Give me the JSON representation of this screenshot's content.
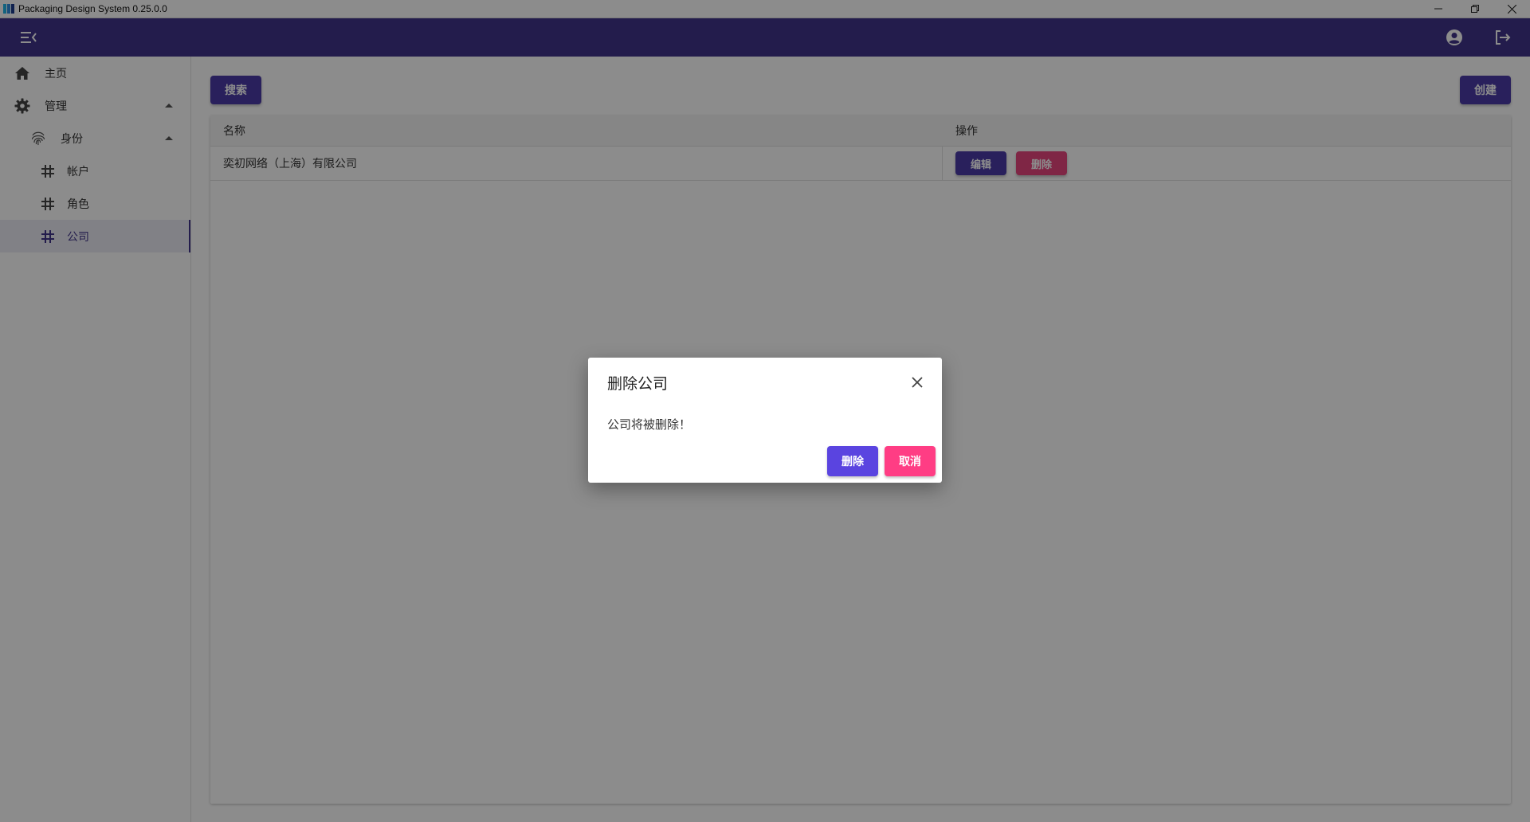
{
  "window": {
    "title": "Packaging Design System 0.25.0.0"
  },
  "colors": {
    "appbar": "#40348a",
    "primary": "#4b3ba8",
    "danger": "#e8457f",
    "dialog_confirm": "#5a44e0",
    "dialog_cancel": "#ff3d84"
  },
  "appbar": {
    "menu_icon": "menu-open-icon",
    "account_icon": "account-circle-icon",
    "logout_icon": "logout-icon"
  },
  "sidebar": {
    "home": {
      "label": "主页",
      "icon": "home-icon"
    },
    "manage": {
      "label": "管理",
      "icon": "gear-icon",
      "expanded": true
    },
    "identity": {
      "label": "身份",
      "icon": "fingerprint-icon",
      "expanded": true
    },
    "items": [
      {
        "label": "帐户",
        "icon": "hash-icon",
        "active": false
      },
      {
        "label": "角色",
        "icon": "hash-icon",
        "active": false
      },
      {
        "label": "公司",
        "icon": "hash-icon",
        "active": true
      }
    ]
  },
  "toolbar": {
    "search_label": "搜索",
    "create_label": "创建"
  },
  "table": {
    "columns": [
      "名称",
      "操作"
    ],
    "rows": [
      {
        "name": "奕初网络（上海）有限公司",
        "edit_label": "编辑",
        "delete_label": "删除"
      }
    ]
  },
  "dialog": {
    "title": "删除公司",
    "message": "公司将被删除！",
    "confirm_label": "删除",
    "cancel_label": "取消",
    "close_icon": "close-icon"
  }
}
